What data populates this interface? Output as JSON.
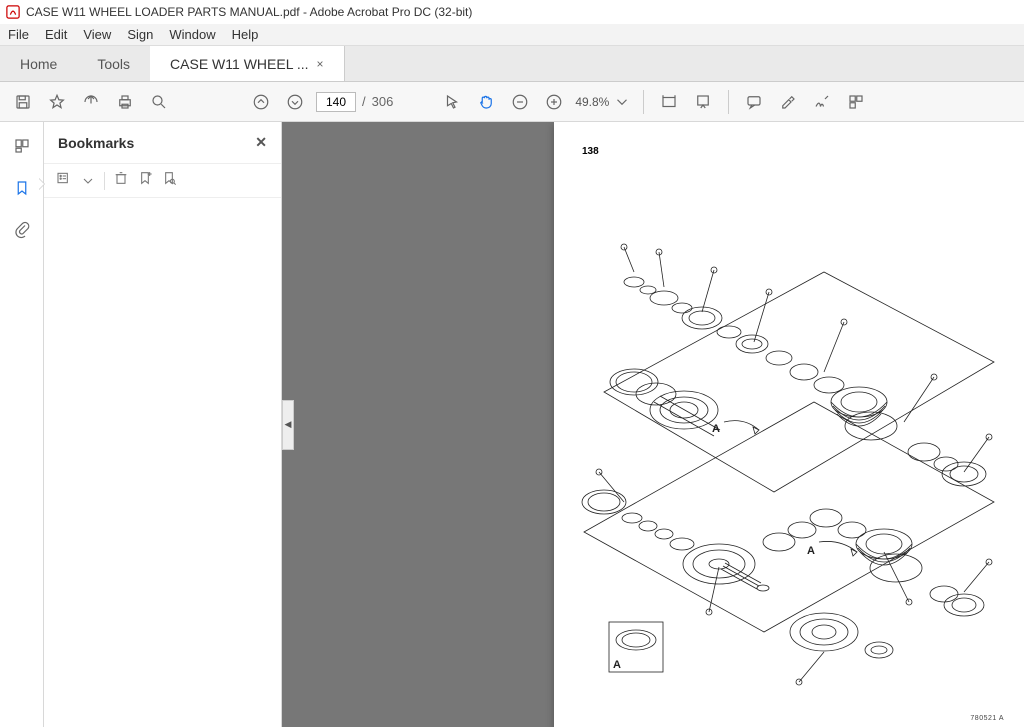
{
  "window": {
    "title": "CASE W11 WHEEL LOADER PARTS MANUAL.pdf - Adobe Acrobat Pro DC (32-bit)"
  },
  "menubar": {
    "items": [
      "File",
      "Edit",
      "View",
      "Sign",
      "Window",
      "Help"
    ]
  },
  "tabs": {
    "home": "Home",
    "tools": "Tools",
    "document": "CASE W11 WHEEL ...",
    "close_glyph": "×"
  },
  "toolbar": {
    "page_current": "140",
    "page_sep": "/",
    "page_total": "306",
    "zoom_value": "49.8%"
  },
  "sidepanel": {
    "title": "Bookmarks"
  },
  "document": {
    "page_number": "138",
    "detail_label": "A",
    "ref_code": "780521 A"
  }
}
